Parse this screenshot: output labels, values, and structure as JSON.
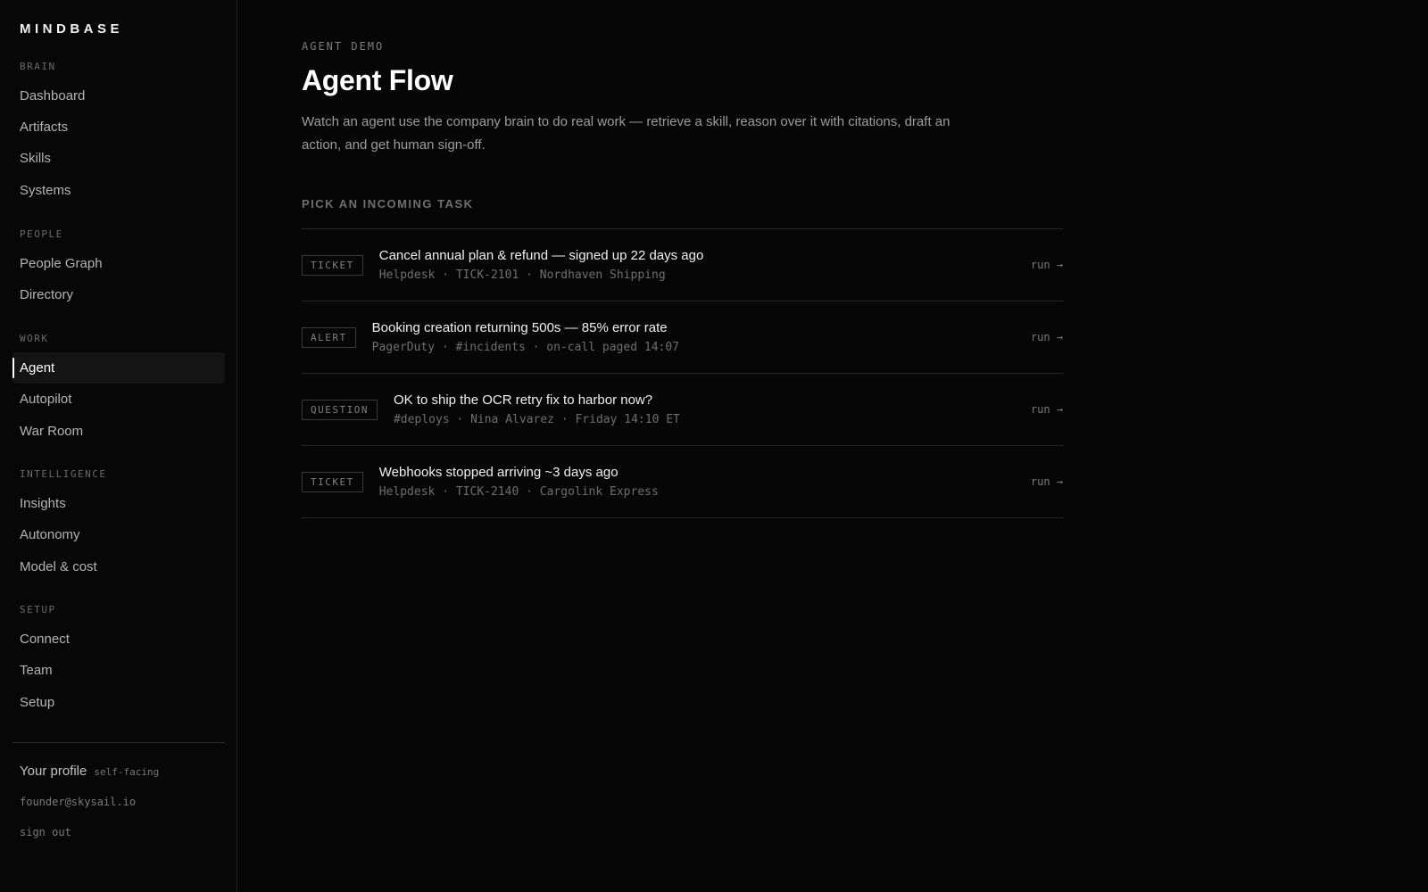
{
  "brand": "MINDBASE",
  "sidebar": {
    "sections": [
      {
        "label": "BRAIN",
        "items": [
          {
            "label": "Dashboard"
          },
          {
            "label": "Artifacts"
          },
          {
            "label": "Skills"
          },
          {
            "label": "Systems"
          }
        ]
      },
      {
        "label": "PEOPLE",
        "items": [
          {
            "label": "People Graph"
          },
          {
            "label": "Directory"
          }
        ]
      },
      {
        "label": "WORK",
        "items": [
          {
            "label": "Agent",
            "active": true
          },
          {
            "label": "Autopilot"
          },
          {
            "label": "War Room"
          }
        ]
      },
      {
        "label": "INTELLIGENCE",
        "items": [
          {
            "label": "Insights"
          },
          {
            "label": "Autonomy"
          },
          {
            "label": "Model & cost"
          }
        ]
      },
      {
        "label": "SETUP",
        "items": [
          {
            "label": "Connect"
          },
          {
            "label": "Team"
          },
          {
            "label": "Setup"
          }
        ]
      }
    ],
    "profile": {
      "label": "Your profile",
      "tag": "self-facing",
      "email": "founder@skysail.io",
      "sign_out": "sign out"
    }
  },
  "main": {
    "eyebrow": "AGENT DEMO",
    "title": "Agent Flow",
    "description": "Watch an agent use the company brain to do real work — retrieve a skill, reason over it with citations, draft an action, and get human sign-off.",
    "section_heading": "PICK AN INCOMING TASK",
    "tasks": [
      {
        "badge": "TICKET",
        "title": "Cancel annual plan & refund — signed up 22 days ago",
        "meta": "Helpdesk · TICK-2101 · Nordhaven Shipping",
        "action": "run →"
      },
      {
        "badge": "ALERT",
        "title": "Booking creation returning 500s — 85% error rate",
        "meta": "PagerDuty · #incidents · on-call paged 14:07",
        "action": "run →"
      },
      {
        "badge": "QUESTION",
        "title": "OK to ship the OCR retry fix to harbor now?",
        "meta": "#deploys · Nina Alvarez · Friday 14:10 ET",
        "action": "run →"
      },
      {
        "badge": "TICKET",
        "title": "Webhooks stopped arriving ~3 days ago",
        "meta": "Helpdesk · TICK-2140 · Cargolink Express",
        "action": "run →"
      }
    ]
  }
}
